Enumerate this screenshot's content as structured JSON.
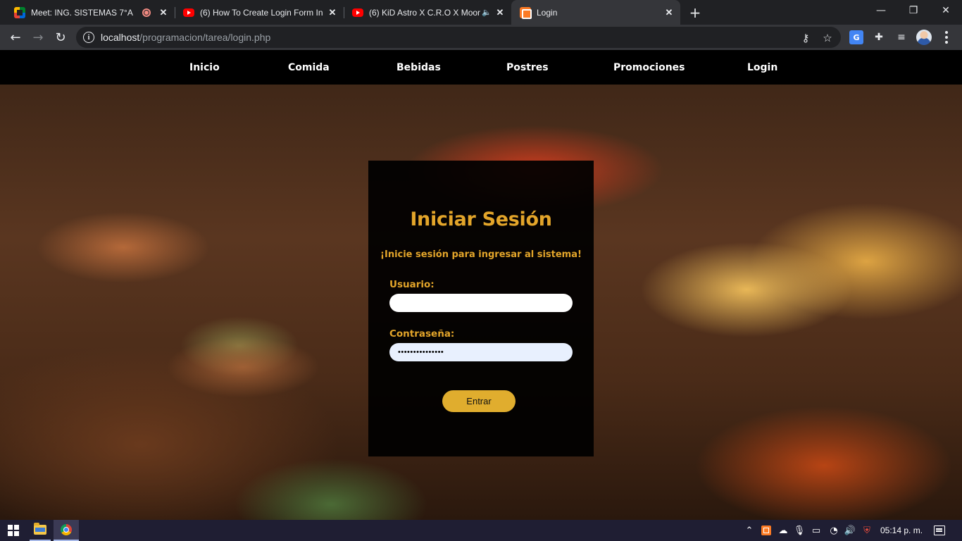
{
  "browser": {
    "tabs": [
      {
        "title": "Meet: ING. SISTEMAS 7°A",
        "favicon": "google-meet-icon",
        "recording": true
      },
      {
        "title": "(6) How To Create Login Form In",
        "favicon": "youtube-icon"
      },
      {
        "title": "(6) KiD Astro X C.R.O X Moon",
        "favicon": "youtube-icon",
        "audio": true
      },
      {
        "title": "Login",
        "favicon": "xampp-icon",
        "active": true
      }
    ],
    "url": {
      "host": "localhost",
      "path": "/programacion/tarea/login.php"
    }
  },
  "site": {
    "nav": [
      "Inicio",
      "Comida",
      "Bebidas",
      "Postres",
      "Promociones",
      "Login"
    ],
    "login": {
      "title": "Iniciar Sesión",
      "subtitle": "¡Inicie sesión para ingresar al sistema!",
      "user_label": "Usuario:",
      "user_value": "",
      "password_label": "Contraseña:",
      "password_value": "•••••••••••••••",
      "submit_label": "Entrar"
    },
    "colors": {
      "accent": "#e3a52a",
      "button": "#e0ad2e",
      "nav_bg": "#000000"
    }
  },
  "taskbar": {
    "clock": "05:14 p. m."
  }
}
